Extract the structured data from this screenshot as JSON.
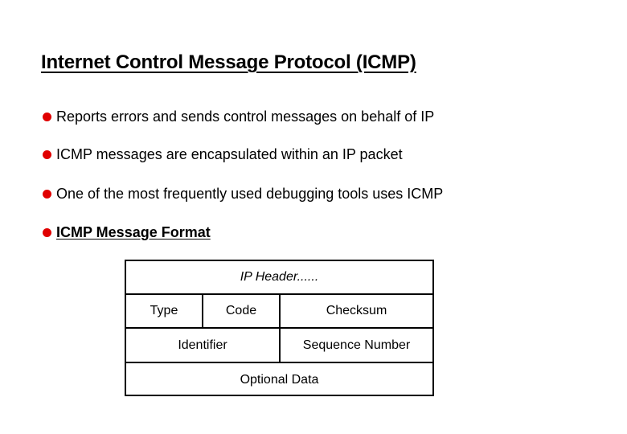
{
  "slide": {
    "title": "Internet Control Message Protocol (ICMP)",
    "bullet_color": "#e00000",
    "bullets": [
      {
        "text": "Reports errors and sends control messages on behalf of IP",
        "emphasis": false
      },
      {
        "text": "ICMP messages are encapsulated within an IP packet",
        "emphasis": false
      },
      {
        "text": "One of the most frequently used debugging tools uses ICMP",
        "emphasis": false
      },
      {
        "text": "ICMP Message Format",
        "emphasis": true
      }
    ]
  },
  "message_format": {
    "rows": [
      {
        "cells": [
          "IP Header......"
        ]
      },
      {
        "cells": [
          "Type",
          "Code",
          "Checksum"
        ]
      },
      {
        "cells": [
          "Identifier",
          "Sequence Number"
        ]
      },
      {
        "cells": [
          "Optional Data"
        ]
      }
    ]
  }
}
